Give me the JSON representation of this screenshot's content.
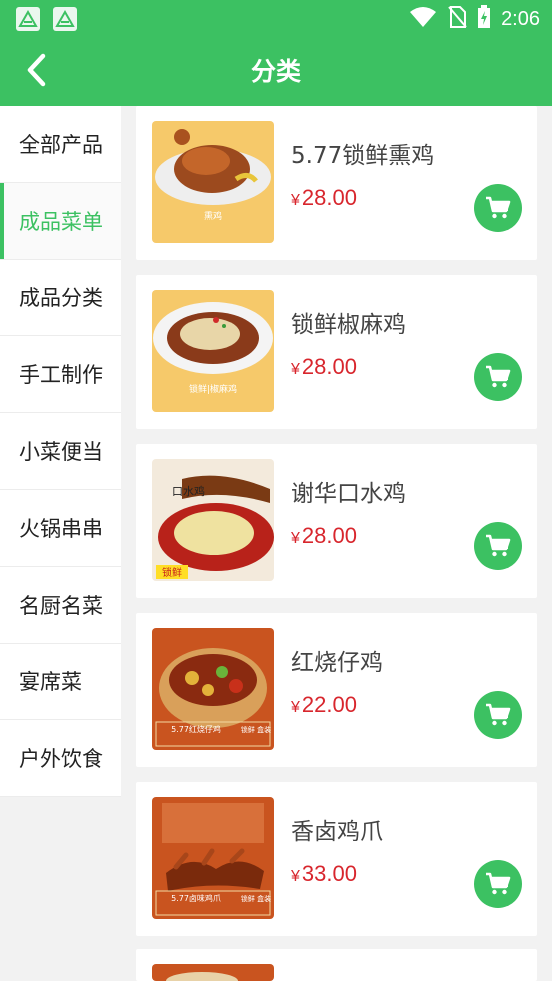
{
  "status_bar": {
    "time": "2:06",
    "icons": [
      "app-icon",
      "app-icon",
      "wifi-icon",
      "no-sim-icon",
      "battery-charging-icon"
    ]
  },
  "header": {
    "title": "分类",
    "back_icon": "chevron-left-icon"
  },
  "sidebar": {
    "items": [
      {
        "label": "全部产品",
        "active": false
      },
      {
        "label": "成品菜单",
        "active": true
      },
      {
        "label": "成品分类",
        "active": false
      },
      {
        "label": "手工制作",
        "active": false
      },
      {
        "label": "小菜便当",
        "active": false
      },
      {
        "label": "火锅串串",
        "active": false
      },
      {
        "label": "名厨名菜",
        "active": false
      },
      {
        "label": "宴席菜",
        "active": false
      },
      {
        "label": "户外饮食",
        "active": false
      }
    ]
  },
  "products": [
    {
      "name": "5.77锁鲜熏鸡",
      "currency": "¥",
      "price": "28.00",
      "image_caption": "熏鸡"
    },
    {
      "name": "锁鲜椒麻鸡",
      "currency": "¥",
      "price": "28.00",
      "image_caption": "锁鲜|椒麻鸡"
    },
    {
      "name": "谢华口水鸡",
      "currency": "¥",
      "price": "28.00",
      "image_caption": "口水鸡",
      "image_tag": "锁鲜"
    },
    {
      "name": "红烧仔鸡",
      "currency": "¥",
      "price": "22.00",
      "image_caption": "5.77红烧仔鸡",
      "image_tag": "锁鲜 盒装"
    },
    {
      "name": "香卤鸡爪",
      "currency": "¥",
      "price": "33.00",
      "image_caption": "5.77卤味鸡爪",
      "image_tag": "锁鲜 盒装"
    },
    {
      "name": "",
      "currency": "",
      "price": ""
    }
  ],
  "cart_icon": "shopping-cart-icon",
  "colors": {
    "brand_green": "#3cc162",
    "price_red": "#d8262d",
    "background": "#f2f2f2"
  }
}
